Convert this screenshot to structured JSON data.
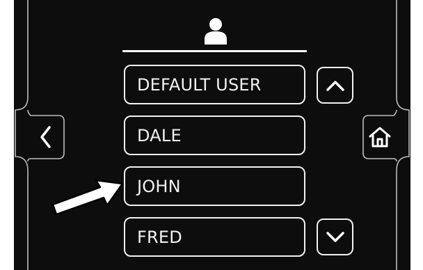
{
  "colors": {
    "screen_background": "#0d0d0d",
    "foreground": "#f2f2f2",
    "page_background": "#ffffff"
  },
  "icons": {
    "header": "user-icon",
    "back": "chevron-left-icon",
    "home": "home-icon",
    "scroll_up": "chevron-up-icon",
    "scroll_down": "chevron-down-icon",
    "callout": "arrow-pointer-icon"
  },
  "user_list": {
    "items": [
      {
        "label": "DEFAULT USER"
      },
      {
        "label": "DALE"
      },
      {
        "label": "JOHN"
      },
      {
        "label": "FRED"
      }
    ],
    "highlighted": "JOHN"
  }
}
